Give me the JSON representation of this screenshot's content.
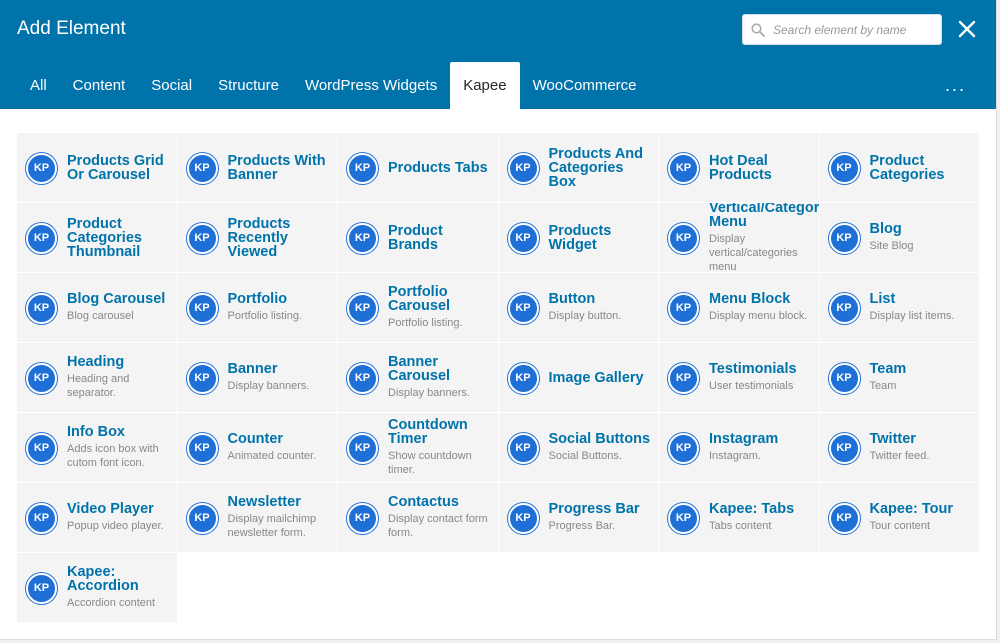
{
  "header": {
    "title": "Add Element",
    "search_placeholder": "Search element by name",
    "more_label": "..."
  },
  "tabs": [
    "All",
    "Content",
    "Social",
    "Structure",
    "WordPress Widgets",
    "Kapee",
    "WooCommerce"
  ],
  "active_tab": "Kapee",
  "badge_text": "KP",
  "colors": {
    "header": "#0073aa",
    "badge": "#1e6fd6",
    "element_name": "#0073aa"
  },
  "elements": [
    {
      "name": "Products Grid Or Carousel",
      "desc": ""
    },
    {
      "name": "Products With Banner",
      "desc": ""
    },
    {
      "name": "Products Tabs",
      "desc": ""
    },
    {
      "name": "Products And Categories Box",
      "desc": ""
    },
    {
      "name": "Hot Deal Products",
      "desc": ""
    },
    {
      "name": "Product Categories",
      "desc": ""
    },
    {
      "name": "Product Categories Thumbnail",
      "desc": ""
    },
    {
      "name": "Products Recently Viewed",
      "desc": ""
    },
    {
      "name": "Product Brands",
      "desc": ""
    },
    {
      "name": "Products Widget",
      "desc": ""
    },
    {
      "name": "Vertical/Categor Menu",
      "desc": "Display vertical/categories menu"
    },
    {
      "name": "Blog",
      "desc": "Site Blog"
    },
    {
      "name": "Blog Carousel",
      "desc": "Blog carousel"
    },
    {
      "name": "Portfolio",
      "desc": "Portfolio listing."
    },
    {
      "name": "Portfolio Carousel",
      "desc": "Portfolio listing."
    },
    {
      "name": "Button",
      "desc": "Display button."
    },
    {
      "name": "Menu Block",
      "desc": "Display menu block."
    },
    {
      "name": "List",
      "desc": "Display list items."
    },
    {
      "name": "Heading",
      "desc": "Heading and separator."
    },
    {
      "name": "Banner",
      "desc": "Display banners."
    },
    {
      "name": "Banner Carousel",
      "desc": "Display banners."
    },
    {
      "name": "Image Gallery",
      "desc": ""
    },
    {
      "name": "Testimonials",
      "desc": "User testimonials"
    },
    {
      "name": "Team",
      "desc": "Team"
    },
    {
      "name": "Info Box",
      "desc": "Adds icon box with cutom font icon."
    },
    {
      "name": "Counter",
      "desc": "Animated counter."
    },
    {
      "name": "Countdown Timer",
      "desc": "Show countdown timer."
    },
    {
      "name": "Social Buttons",
      "desc": "Social Buttons."
    },
    {
      "name": "Instagram",
      "desc": "Instagram."
    },
    {
      "name": "Twitter",
      "desc": "Twitter feed."
    },
    {
      "name": "Video Player",
      "desc": "Popup video player."
    },
    {
      "name": "Newsletter",
      "desc": "Display mailchimp newsletter form."
    },
    {
      "name": "Contactus",
      "desc": "Display contact form form."
    },
    {
      "name": "Progress Bar",
      "desc": "Progress Bar."
    },
    {
      "name": "Kapee: Tabs",
      "desc": "Tabs content"
    },
    {
      "name": "Kapee: Tour",
      "desc": "Tour content"
    },
    {
      "name": "Kapee: Accordion",
      "desc": "Accordion content"
    }
  ]
}
